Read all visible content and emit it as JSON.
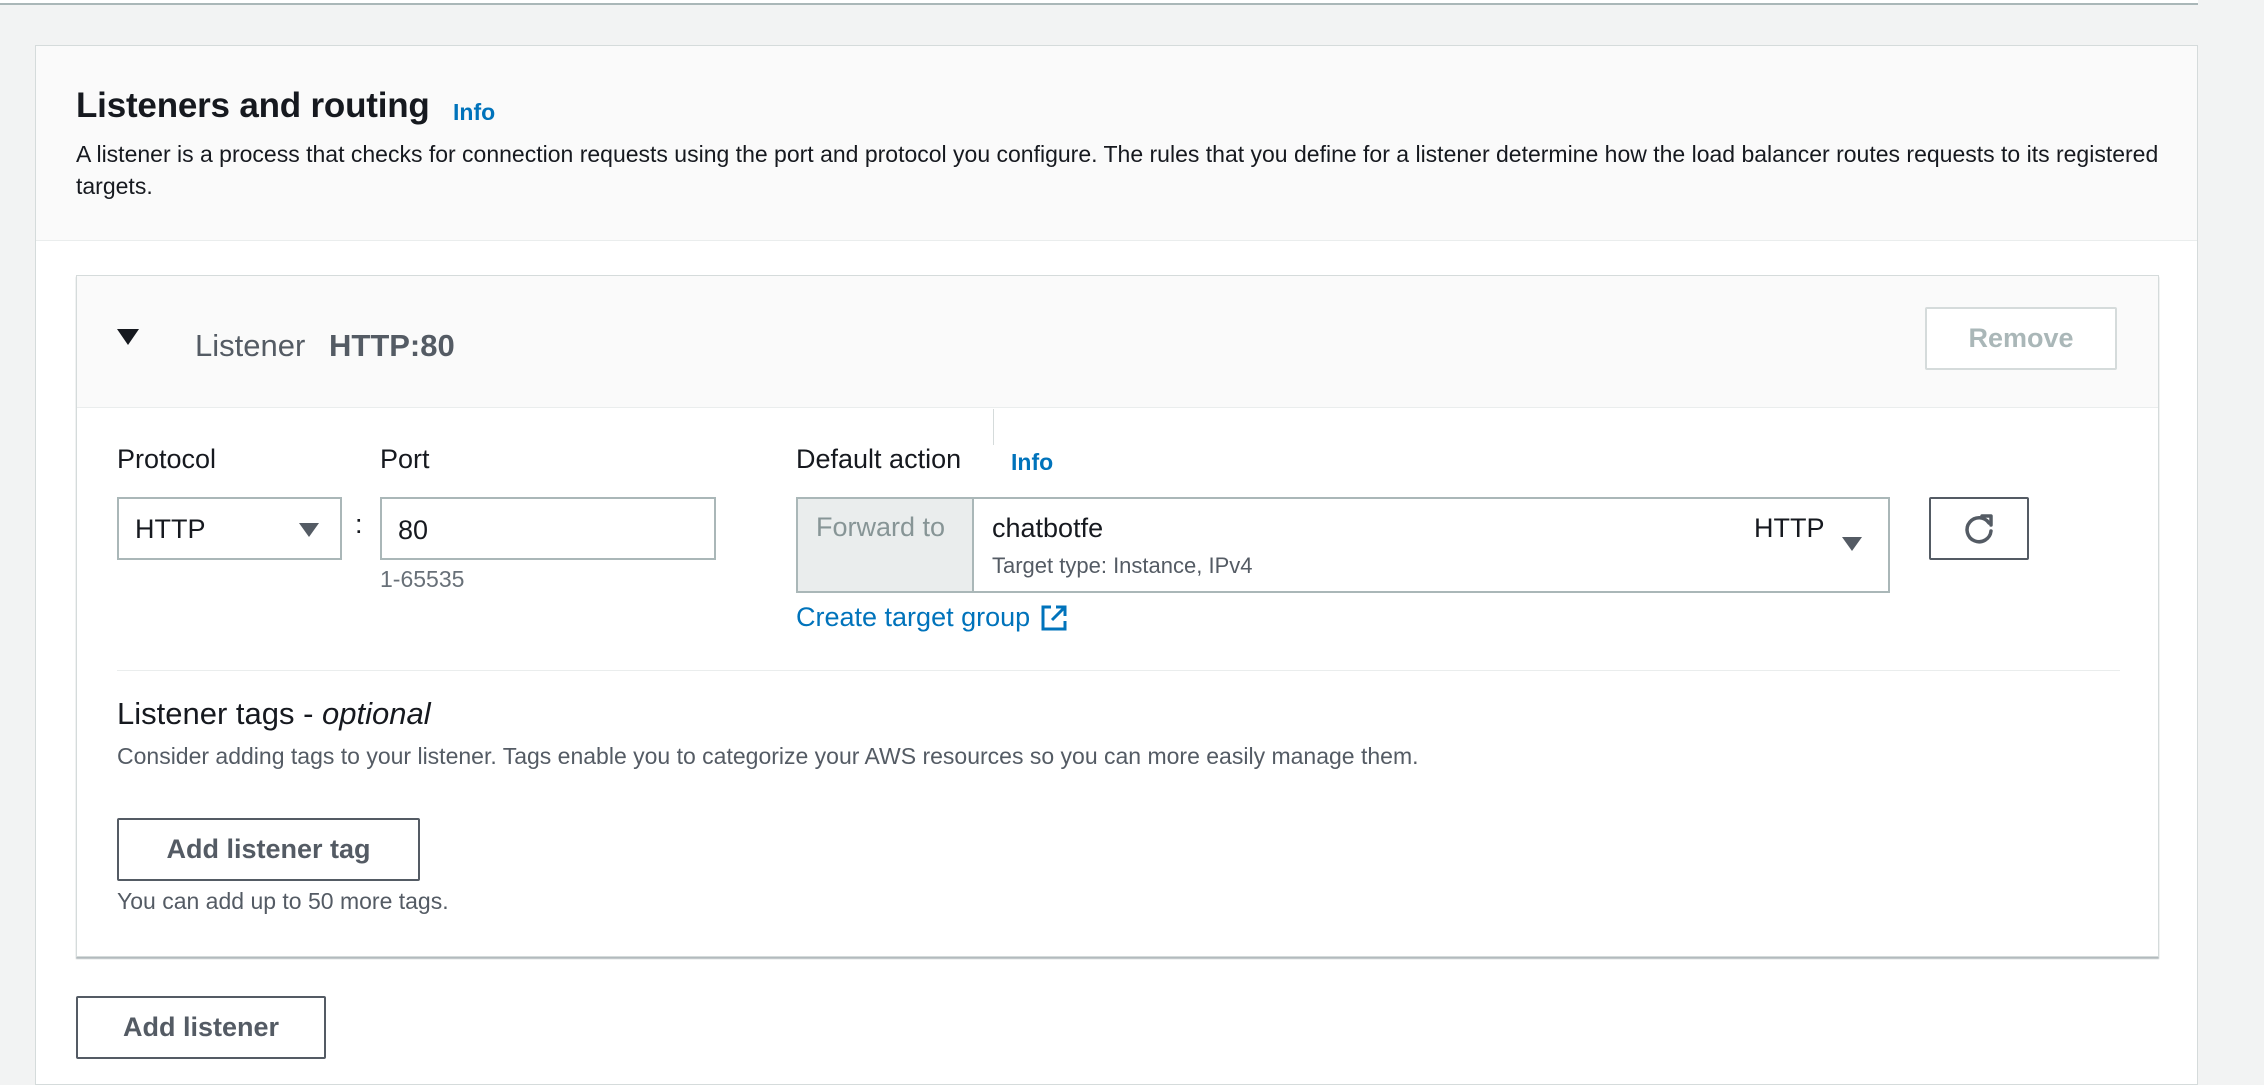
{
  "section": {
    "title": "Listeners and routing",
    "info": "Info",
    "description": "A listener is a process that checks for connection requests using the port and protocol you configure. The rules that you define for a listener determine how the load balancer routes requests to its registered targets."
  },
  "listener": {
    "label": "Listener",
    "value": "HTTP:80",
    "remove_label": "Remove",
    "protocol": {
      "label": "Protocol",
      "value": "HTTP"
    },
    "port": {
      "label": "Port",
      "value": "80",
      "hint": "1-65535",
      "separator": ":"
    },
    "default_action": {
      "label": "Default action",
      "info": "Info",
      "forward_label": "Forward to",
      "target_group_name": "chatbotfe",
      "target_group_type": "Target type: Instance, IPv4",
      "target_group_protocol": "HTTP",
      "create_link": "Create target group"
    },
    "tags": {
      "title": "Listener tags - ",
      "title_suffix": "optional",
      "description": "Consider adding tags to your listener. Tags enable you to categorize your AWS resources so you can more easily manage them.",
      "add_label": "Add listener tag",
      "hint": "You can add up to 50 more tags."
    }
  },
  "add_listener_label": "Add listener",
  "icons": {
    "expand": "caret-down-icon",
    "protocol_dropdown": "dropdown-arrow-icon",
    "target_dropdown": "dropdown-arrow-icon",
    "refresh": "refresh-icon",
    "external": "external-link-icon"
  },
  "colors": {
    "link": "#0073bb",
    "border": "#aab7b8",
    "text": "#16191f",
    "muted": "#545b64"
  }
}
